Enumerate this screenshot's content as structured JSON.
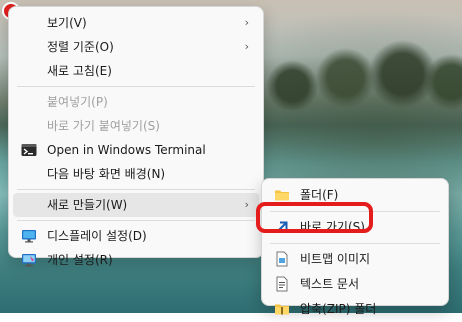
{
  "main_menu": {
    "items": [
      {
        "label": "보기(V)",
        "submenu": true
      },
      {
        "label": "정렬 기준(O)",
        "submenu": true
      },
      {
        "label": "새로 고침(E)"
      },
      {
        "label": "붙여넣기(P)",
        "disabled": true
      },
      {
        "label": "바로 가기 붙여넣기(S)",
        "disabled": true
      },
      {
        "label": "Open in Windows Terminal",
        "icon": "terminal-icon"
      },
      {
        "label": "다음 바탕 화면 배경(N)"
      },
      {
        "label": "새로 만들기(W)",
        "submenu": true,
        "active": true
      },
      {
        "label": "디스플레이 설정(D)",
        "icon": "display-icon"
      },
      {
        "label": "개인 설정(R)",
        "icon": "personalize-icon"
      }
    ],
    "chevron": "›"
  },
  "new_submenu": {
    "items": [
      {
        "label": "폴더(F)",
        "icon": "folder-icon"
      },
      {
        "label": "바로 가기(S)",
        "icon": "shortcut-arrow-icon",
        "highlighted": true
      },
      {
        "label": "비트맵 이미지",
        "icon": "bitmap-icon"
      },
      {
        "label": "텍스트 문서",
        "icon": "text-document-icon"
      },
      {
        "label": "압축(ZIP) 폴더",
        "icon": "zip-folder-icon"
      }
    ]
  },
  "annotation": {
    "highlight_color": "#e41c1c"
  }
}
